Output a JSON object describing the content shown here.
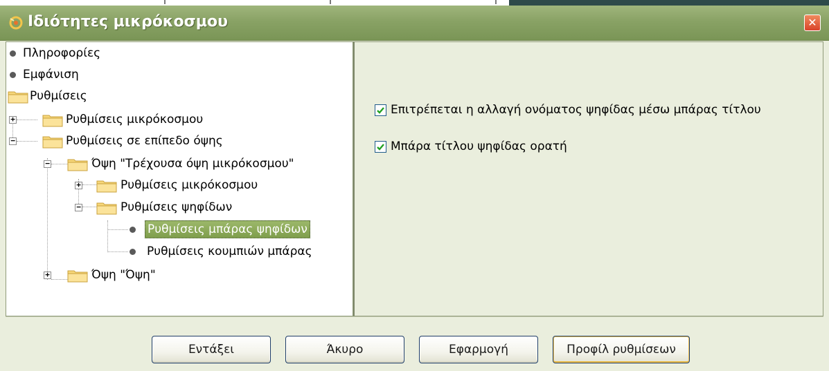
{
  "dialog": {
    "title": "Ιδιότητες μικρόκοσμου",
    "close_icon": "close-icon",
    "accent_color": "#89a265"
  },
  "tree": {
    "items": [
      {
        "label": "Πληροφορίες",
        "icon": "bullet-icon"
      },
      {
        "label": "Εμφάνιση",
        "icon": "bullet-icon"
      },
      {
        "label": "Ρυθμίσεις",
        "icon": "folder-icon"
      },
      {
        "label": "Ρυθμίσεις μικρόκοσμου",
        "icon": "folder-icon",
        "expander": "+"
      },
      {
        "label": "Ρυθμίσεις σε επίπεδο όψης",
        "icon": "folder-icon",
        "expander": "−"
      },
      {
        "label": "Όψη \"Τρέχουσα όψη μικρόκοσμου\"",
        "icon": "folder-icon",
        "expander": "−"
      },
      {
        "label": "Ρυθμίσεις μικρόκοσμου",
        "icon": "folder-icon",
        "expander": "+"
      },
      {
        "label": "Ρυθμίσεις ψηφίδων",
        "icon": "folder-icon",
        "expander": "−"
      },
      {
        "label": "Ρυθμίσεις μπάρας ψηφίδων",
        "icon": "bullet-icon",
        "selected": true
      },
      {
        "label": "Ρυθμίσεις κουμπιών μπάρας",
        "icon": "bullet-icon"
      },
      {
        "label": "Όψη \"Όψη\"",
        "icon": "folder-icon",
        "expander": "+"
      }
    ]
  },
  "settings": {
    "options": [
      {
        "label": "Επιτρέπεται η αλλαγή ονόματος ψηφίδας μέσω μπάρας τίτλου",
        "checked": true
      },
      {
        "label": "Μπάρα τίτλου ψηφίδας ορατή",
        "checked": true
      }
    ]
  },
  "buttons": {
    "ok": "Εντάξει",
    "cancel": "Άκυρο",
    "apply": "Εφαρμογή",
    "profiles": "Προφίλ ρυθμίσεων"
  }
}
